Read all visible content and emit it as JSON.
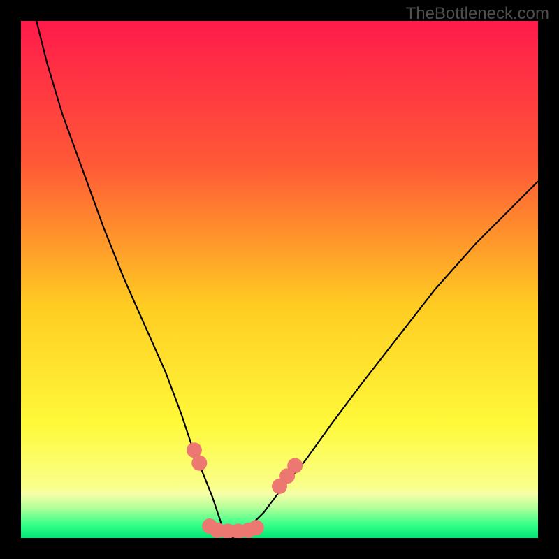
{
  "watermark": "TheBottleneck.com",
  "chart_data": {
    "type": "line",
    "title": "",
    "xlabel": "",
    "ylabel": "",
    "xlim": [
      0,
      100
    ],
    "ylim": [
      0,
      100
    ],
    "series": [
      {
        "name": "bottleneck-curve",
        "x": [
          3,
          5,
          8,
          12,
          16,
          20,
          24,
          28,
          31,
          33,
          35,
          37,
          38,
          39,
          40.5,
          42,
          44,
          47,
          50,
          55,
          60,
          66,
          73,
          80,
          88,
          96,
          100
        ],
        "y": [
          100,
          92,
          82,
          71,
          60,
          50,
          41,
          32,
          24,
          18,
          13,
          8,
          5,
          2,
          0,
          0,
          2,
          5,
          9,
          15,
          22,
          30,
          39,
          48,
          57,
          65,
          69
        ]
      }
    ],
    "markers": {
      "name": "highlight-points",
      "color": "#ed7872",
      "points": [
        {
          "x": 33.5,
          "y": 17
        },
        {
          "x": 34.5,
          "y": 14.5
        },
        {
          "x": 36.5,
          "y": 2.3
        },
        {
          "x": 38,
          "y": 1.5
        },
        {
          "x": 40,
          "y": 1.3
        },
        {
          "x": 42,
          "y": 1.3
        },
        {
          "x": 44,
          "y": 1.5
        },
        {
          "x": 45.5,
          "y": 2
        },
        {
          "x": 50,
          "y": 10
        },
        {
          "x": 51.5,
          "y": 12
        },
        {
          "x": 53,
          "y": 14
        }
      ]
    },
    "bottom_band": {
      "color_start": "#00ff7a",
      "color_end": "#f6ffb0",
      "y_fraction_top": 0.915,
      "y_fraction_bottom": 1.0
    },
    "gradient_stops": [
      {
        "offset": 0.0,
        "color": "#ff1a4b"
      },
      {
        "offset": 0.28,
        "color": "#ff5a36"
      },
      {
        "offset": 0.55,
        "color": "#ffcc22"
      },
      {
        "offset": 0.78,
        "color": "#fff93a"
      },
      {
        "offset": 0.9,
        "color": "#f9ff8a"
      },
      {
        "offset": 0.915,
        "color": "#f5ffa8"
      },
      {
        "offset": 0.94,
        "color": "#b7ff9a"
      },
      {
        "offset": 0.975,
        "color": "#33ff88"
      },
      {
        "offset": 1.0,
        "color": "#00e673"
      }
    ]
  }
}
